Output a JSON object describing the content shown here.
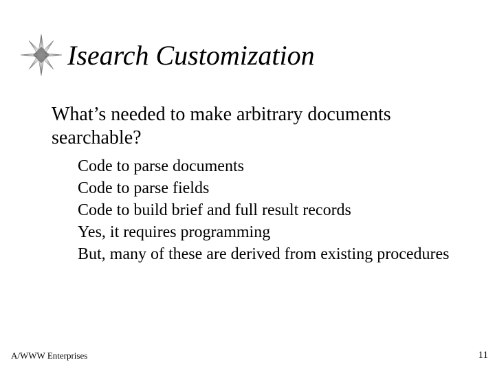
{
  "title": "Isearch Customization",
  "bullets": [
    {
      "text": "What’s needed to make arbitrary documents searchable?",
      "children": [
        "Code to parse documents",
        "Code to parse fields",
        "Code to build brief and full result records",
        "Yes, it requires programming",
        "But, many of these are derived from existing procedures"
      ]
    }
  ],
  "footer": {
    "left": "A/WWW Enterprises",
    "page": "11"
  }
}
